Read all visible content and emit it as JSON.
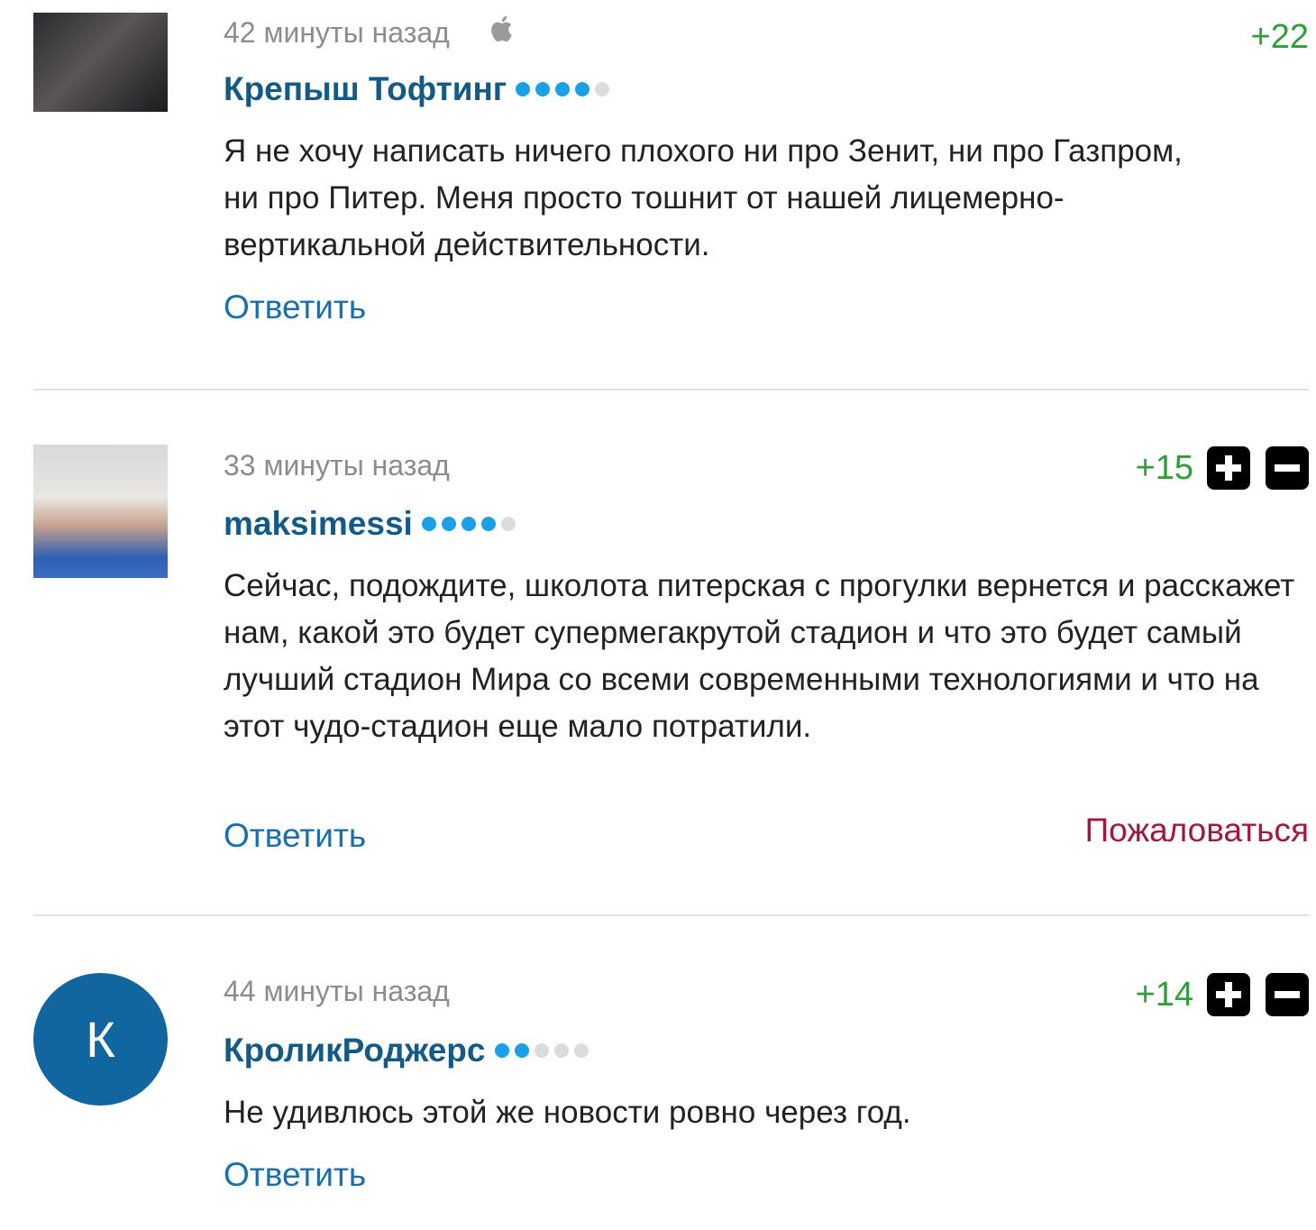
{
  "comments": [
    {
      "time": "42 минуты назад",
      "author": "Крепыш Тофтинг",
      "rating_dots": {
        "filled": 4,
        "total": 5
      },
      "score": "+22",
      "text": "Я не хочу написать ничего плохого ни про Зенит, ни про Газпром, ни про Питер. Меня просто тошнит от нашей лицемерно-вертикальной действительности.",
      "reply_label": "Ответить",
      "device_icon": "apple-icon"
    },
    {
      "time": "33 минуты назад",
      "author": "maksimessi",
      "rating_dots": {
        "filled": 4,
        "total": 5
      },
      "score": "+15",
      "text": "Сейчас, подождите, школота питерская с прогулки вернется и расскажет нам, какой это будет супермегакрутой стадион и что это будет самый лучший стадион Мира со всеми современными технологиями и что на этот чудо-стадион еще мало потратили.",
      "reply_label": "Ответить",
      "complain_label": "Пожаловаться"
    },
    {
      "time": "44 минуты назад",
      "author": "КроликРоджерс",
      "avatar_letter": "К",
      "rating_dots": {
        "filled": 2,
        "total": 5
      },
      "score": "+14",
      "text": "Не удивлюсь этой же новости ровно через год.",
      "reply_label": "Ответить"
    }
  ],
  "colors": {
    "author": "#135a86",
    "link": "#1b6eac",
    "score_positive": "#2f9d3a",
    "complain": "#a2183c",
    "dot_on": "#1aa0e6",
    "dot_off": "#dcdcdc"
  }
}
